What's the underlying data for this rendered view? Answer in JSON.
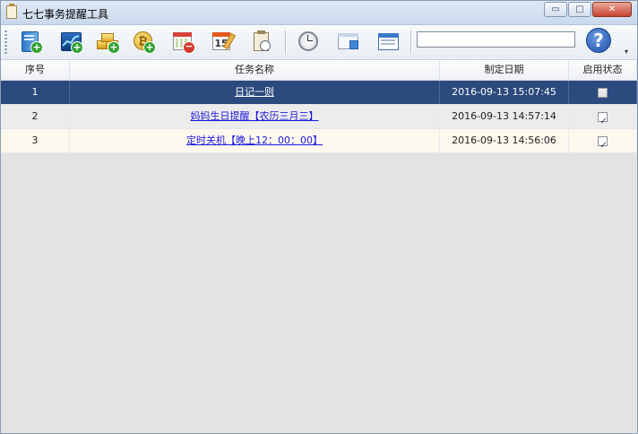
{
  "window": {
    "title": "七七事务提醒工具",
    "controls": {
      "minimize": "▭",
      "maximize": "□",
      "close": "✕"
    }
  },
  "toolbar": {
    "buttons": [
      "add-document-icon",
      "add-stock-chart-icon",
      "add-gold-icon",
      "add-bitcoin-icon",
      "remove-calendar-icon",
      "calendar-pencil-icon",
      "clipboard-clock-icon",
      "clock-icon",
      "window-search-icon",
      "window-list-icon"
    ],
    "calendar_day": "15",
    "search_value": "",
    "help_glyph": "?",
    "overflow_glyph": "▾"
  },
  "table": {
    "headers": [
      "序号",
      "任务名称",
      "制定日期",
      "启用状态"
    ],
    "rows": [
      {
        "index": "1",
        "name": "日记一则",
        "date": "2016-09-13 15:07:45",
        "enabled": false,
        "selected": true
      },
      {
        "index": "2",
        "name": "妈妈生日提醒【农历三月三】",
        "date": "2016-09-13 14:57:14",
        "enabled": true,
        "selected": false
      },
      {
        "index": "3",
        "name": "定时关机【晚上12：00：00】",
        "date": "2016-09-13 14:56:06",
        "enabled": true,
        "selected": false
      }
    ]
  },
  "colors": {
    "selected_row": "#2b4a7d",
    "link": "#1a1ae0",
    "alt_row": "#fdf8ee",
    "empty_area": "#e3e3e3"
  }
}
